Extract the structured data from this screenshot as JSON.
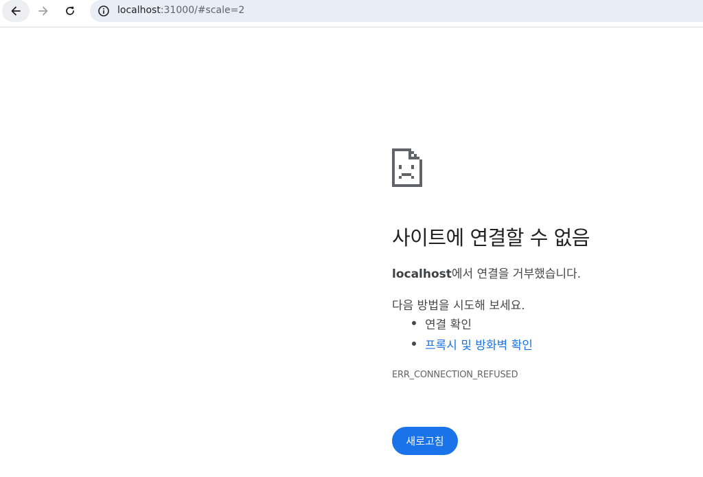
{
  "browser": {
    "url_host": "localhost",
    "url_rest": ":31000/#scale=2",
    "icons": {
      "back": "back-arrow-icon",
      "forward": "forward-arrow-icon",
      "reload": "reload-icon",
      "info": "info-icon"
    }
  },
  "error_page": {
    "icon": "sad-document-icon",
    "title": "사이트에 연결할 수 없음",
    "host": "localhost",
    "detail_suffix": "에서 연결을 거부했습니다.",
    "suggestions_heading": "다음 방법을 시도해 보세요.",
    "suggestions": [
      {
        "label": "연결 확인",
        "is_link": false
      },
      {
        "label": "프록시 및 방화벽 확인",
        "is_link": true
      }
    ],
    "error_code": "ERR_CONNECTION_REFUSED",
    "reload_button": "새로고침"
  },
  "colors": {
    "accent": "#1a73e8",
    "text_primary": "#202124",
    "text_secondary": "#474747",
    "omnibox_bg": "#e9eef6"
  }
}
